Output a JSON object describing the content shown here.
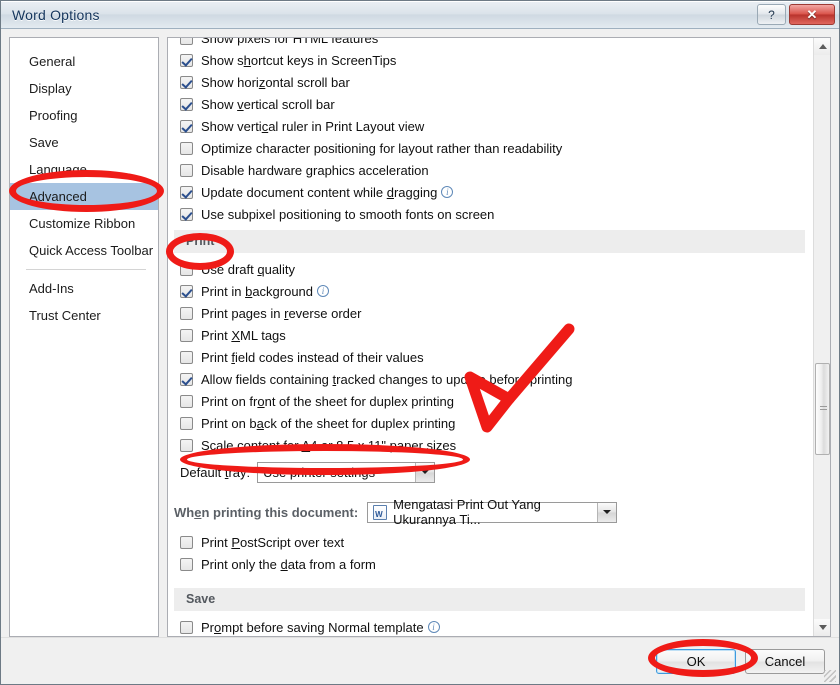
{
  "window": {
    "title": "Word Options",
    "help_button": "?",
    "close_button": "✕",
    "help_icon_name": "help-icon",
    "close_icon_name": "close-icon"
  },
  "sidebar": {
    "items": [
      {
        "label": "General",
        "selected": false
      },
      {
        "label": "Display",
        "selected": false
      },
      {
        "label": "Proofing",
        "selected": false
      },
      {
        "label": "Save",
        "selected": false
      },
      {
        "label": "Language",
        "selected": false
      },
      {
        "label": "Advanced",
        "selected": true
      },
      {
        "label": "Customize Ribbon",
        "selected": false
      },
      {
        "label": "Quick Access Toolbar",
        "selected": false
      },
      {
        "label": "Add-Ins",
        "selected": false
      },
      {
        "label": "Trust Center",
        "selected": false
      }
    ]
  },
  "options": {
    "partial_top": {
      "label": "Show pixels for HTML features",
      "checked": false
    },
    "display_group": [
      {
        "pre": "Show s",
        "acc": "h",
        "post": "ortcut keys in ScreenTips",
        "checked": true,
        "info": false
      },
      {
        "pre": "Show hori",
        "acc": "z",
        "post": "ontal scroll bar",
        "checked": true,
        "info": false
      },
      {
        "pre": "Show ",
        "acc": "v",
        "post": "ertical scroll bar",
        "checked": true,
        "info": false
      },
      {
        "pre": "Show verti",
        "acc": "c",
        "post": "al ruler in Print Layout view",
        "checked": true,
        "info": false
      },
      {
        "pre": "Optimize character positioning for layout rather than readability",
        "acc": "",
        "post": "",
        "checked": false,
        "info": false
      },
      {
        "pre": "Disable hardware ",
        "acc": "g",
        "post": "raphics acceleration",
        "checked": false,
        "info": false
      },
      {
        "pre": "Update document content while ",
        "acc": "d",
        "post": "ragging",
        "checked": true,
        "info": true
      },
      {
        "pre": "Use subpixel positioning to smooth fonts on screen",
        "acc": "",
        "post": "",
        "checked": true,
        "info": false
      }
    ],
    "print_section": {
      "header": "Print",
      "items": [
        {
          "pre": "Use draft ",
          "acc": "q",
          "post": "uality",
          "checked": false,
          "info": false
        },
        {
          "pre": "Print in ",
          "acc": "b",
          "post": "ackground",
          "checked": true,
          "info": true
        },
        {
          "pre": "Print pages in ",
          "acc": "r",
          "post": "everse order",
          "checked": false,
          "info": false
        },
        {
          "pre": "Print ",
          "acc": "X",
          "post": "ML tags",
          "checked": false,
          "info": false
        },
        {
          "pre": "Print ",
          "acc": "f",
          "post": "ield codes instead of their values",
          "checked": false,
          "info": false
        },
        {
          "pre": "Allow fields containing ",
          "acc": "t",
          "post": "racked changes to update before printing",
          "checked": true,
          "info": false
        },
        {
          "pre": "Print on fr",
          "acc": "o",
          "post": "nt of the sheet for duplex printing",
          "checked": false,
          "info": false
        },
        {
          "pre": "Print on b",
          "acc": "a",
          "post": "ck of the sheet for duplex printing",
          "checked": false,
          "info": false
        },
        {
          "pre": "Scale content for ",
          "acc": "A",
          "post": "4 or 8.5 x 11\" paper sizes",
          "checked": false,
          "info": false
        }
      ],
      "default_tray": {
        "label_pre": "Default ",
        "label_acc": "t",
        "label_post": "ray:",
        "value": "Use printer settings"
      }
    },
    "when_printing": {
      "label_pre": "Wh",
      "label_acc": "e",
      "label_post": "n printing this document:",
      "document_value": "Mengatasi Print Out Yang Ukurannya Ti...",
      "document_icon_name": "word-document-icon",
      "items": [
        {
          "pre": "Print ",
          "acc": "P",
          "post": "ostScript over text",
          "checked": false,
          "info": false
        },
        {
          "pre": "Print only the ",
          "acc": "d",
          "post": "ata from a form",
          "checked": false,
          "info": false
        }
      ]
    },
    "save_section": {
      "header": "Save",
      "items": [
        {
          "pre": "Pr",
          "acc": "o",
          "post": "mpt before saving Normal template",
          "checked": false,
          "info": true
        }
      ]
    }
  },
  "footer": {
    "ok_label": "OK",
    "cancel_label": "Cancel"
  },
  "annotations": {
    "color": "#ef1b17",
    "marks": [
      {
        "name": "advanced-highlight",
        "shape": "ellipse"
      },
      {
        "name": "print-header-highlight",
        "shape": "ellipse"
      },
      {
        "name": "scale-content-highlight",
        "shape": "ellipse"
      },
      {
        "name": "ok-button-highlight",
        "shape": "ellipse"
      },
      {
        "name": "pointer-arrow",
        "shape": "arrow"
      }
    ]
  }
}
